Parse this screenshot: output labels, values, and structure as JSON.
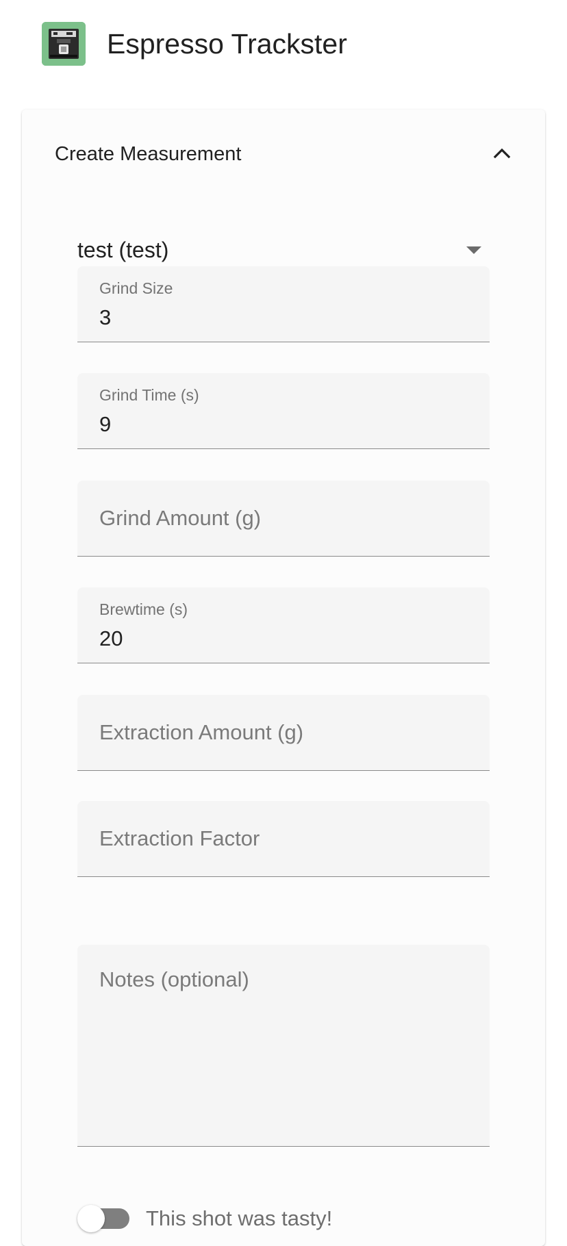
{
  "header": {
    "title": "Espresso Trackster",
    "logo_icon": "espresso-machine-icon"
  },
  "card": {
    "title": "Create Measurement",
    "collapse_icon": "chevron-up-icon",
    "coffee_select": {
      "value": "test (test)"
    },
    "fields": {
      "grind_size": {
        "label": "Grind Size",
        "value": "3"
      },
      "grind_time": {
        "label": "Grind Time (s)",
        "value": "9"
      },
      "grind_amount": {
        "placeholder": "Grind Amount (g)"
      },
      "brewtime": {
        "label": "Brewtime (s)",
        "value": "20"
      },
      "extraction_amount": {
        "placeholder": "Extraction Amount (g)"
      },
      "extraction_factor": {
        "placeholder": "Extraction Factor"
      },
      "notes": {
        "placeholder": "Notes (optional)"
      }
    },
    "tasty_toggle": {
      "label": "This shot was tasty!",
      "checked": false
    }
  },
  "colors": {
    "logo_bg": "#7cc08a",
    "field_bg": "#f5f5f5",
    "toggle_track": "#7f7f7f"
  }
}
